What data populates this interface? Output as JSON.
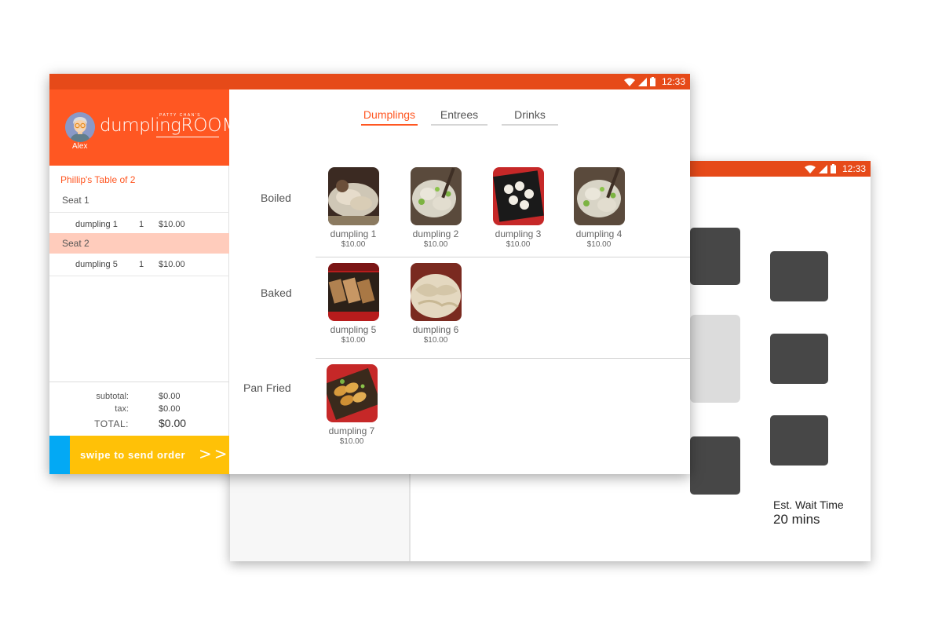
{
  "status_bar": {
    "time": "12:33"
  },
  "back_screen": {
    "status_time": "12:33",
    "wait_label": "Est. Wait Time",
    "wait_value": "20 mins"
  },
  "sidebar": {
    "user_name": "Alex",
    "logo_tagline": "PATTY CHAN'S",
    "logo_word": "dumpling",
    "logo_room": "ROOM",
    "table_title": "Phillip's Table of 2",
    "seats": [
      {
        "label": "Seat 1",
        "items": [
          {
            "name": "dumpling 1",
            "qty": "1",
            "price": "$10.00"
          }
        ]
      },
      {
        "label": "Seat 2",
        "items": [
          {
            "name": "dumpling 5",
            "qty": "1",
            "price": "$10.00"
          }
        ]
      }
    ],
    "totals": {
      "subtotal_label": "subtotal:",
      "subtotal_value": "$0.00",
      "tax_label": "tax:",
      "tax_value": "$0.00",
      "total_label": "TOTAL:",
      "total_value": "$0.00"
    },
    "swipe_label": "swipe to send order",
    "swipe_arrows": ">>"
  },
  "main": {
    "tabs": [
      {
        "label": "Dumplings"
      },
      {
        "label": "Entrees"
      },
      {
        "label": "Drinks"
      }
    ],
    "categories": [
      {
        "label": "Boiled"
      },
      {
        "label": "Baked"
      },
      {
        "label": "Pan Fried"
      }
    ],
    "dishes": [
      {
        "name": "dumpling 1",
        "price": "$10.00"
      },
      {
        "name": "dumpling 2",
        "price": "$10.00"
      },
      {
        "name": "dumpling 3",
        "price": "$10.00"
      },
      {
        "name": "dumpling 4",
        "price": "$10.00"
      },
      {
        "name": "dumpling 5",
        "price": "$10.00"
      },
      {
        "name": "dumpling 6",
        "price": "$10.00"
      },
      {
        "name": "dumpling 7",
        "price": "$10.00"
      }
    ]
  },
  "colors": {
    "status_bar": "#e64a19",
    "header": "#ff5722",
    "active_seat": "#ffccbc",
    "swipe_bar": "#ffc107",
    "swipe_handle": "#03a9f4",
    "table_dark": "#474747"
  },
  "icons": [
    "wifi-icon",
    "signal-icon",
    "battery-icon",
    "avatar-icon",
    "double-chevron-right-icon"
  ]
}
